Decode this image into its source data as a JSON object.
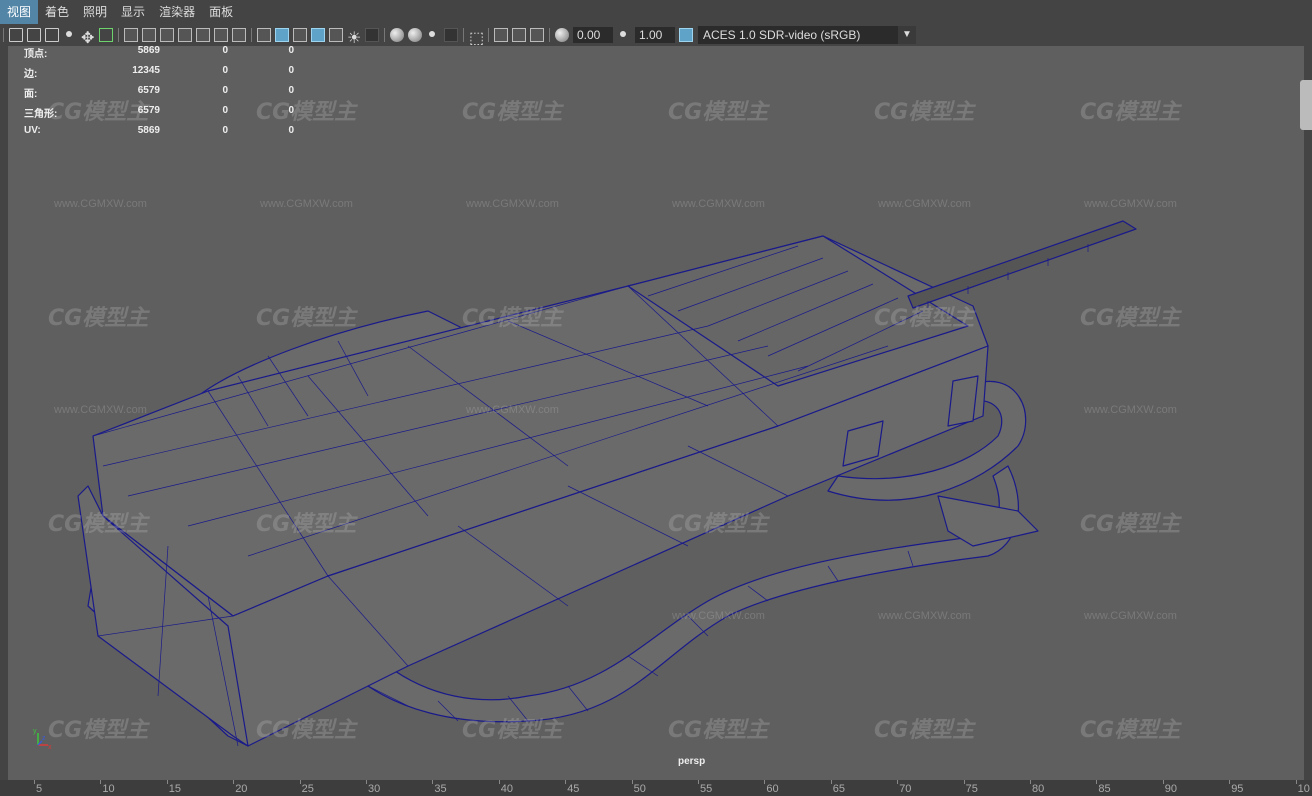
{
  "menubar": {
    "items": [
      {
        "label": "视图",
        "active": true
      },
      {
        "label": "着色"
      },
      {
        "label": "照明"
      },
      {
        "label": "显示"
      },
      {
        "label": "渲染器"
      },
      {
        "label": "面板"
      }
    ]
  },
  "toolbar": {
    "exposure_value": "0.00",
    "gamma_value": "1.00",
    "color_space": "ACES 1.0 SDR-video (sRGB)",
    "accent_color": "#5fa3c9"
  },
  "hud": {
    "rows": [
      {
        "label": "顶点:",
        "a": "5869",
        "b": "0",
        "c": "0"
      },
      {
        "label": "边:",
        "a": "12345",
        "b": "0",
        "c": "0"
      },
      {
        "label": "面:",
        "a": "6579",
        "b": "0",
        "c": "0"
      },
      {
        "label": "三角形:",
        "a": "6579",
        "b": "0",
        "c": "0"
      },
      {
        "label": "UV:",
        "a": "5869",
        "b": "0",
        "c": "0"
      }
    ]
  },
  "viewport": {
    "camera": "persp",
    "wireframe_color": "#1a1a8a",
    "watermark_logo": "CG模型主",
    "watermark_url": "www.CGMXW.com"
  },
  "axis": {
    "y": "y",
    "x": "x",
    "z": "z"
  },
  "timeline": {
    "ticks": [
      "5",
      "10",
      "15",
      "20",
      "25",
      "30",
      "35",
      "40",
      "45",
      "50",
      "55",
      "60",
      "65",
      "70",
      "75",
      "80",
      "85",
      "90",
      "95",
      "10"
    ]
  }
}
